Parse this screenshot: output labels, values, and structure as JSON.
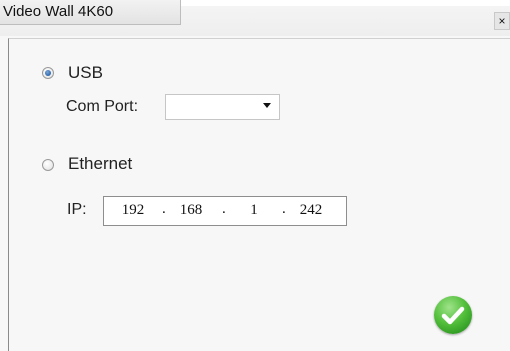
{
  "window": {
    "title": "Video Wall 4K60",
    "close_glyph": "×"
  },
  "usb": {
    "label": "USB",
    "selected": true,
    "com_port_label": "Com Port:",
    "com_port_value": ""
  },
  "ethernet": {
    "label": "Ethernet",
    "selected": false,
    "ip_label": "IP:",
    "ip": [
      "192",
      "168",
      "1",
      "242"
    ],
    "ip_separator": "."
  },
  "actions": {
    "ok_icon": "checkmark-icon",
    "ok_color": "#3fae2a"
  }
}
